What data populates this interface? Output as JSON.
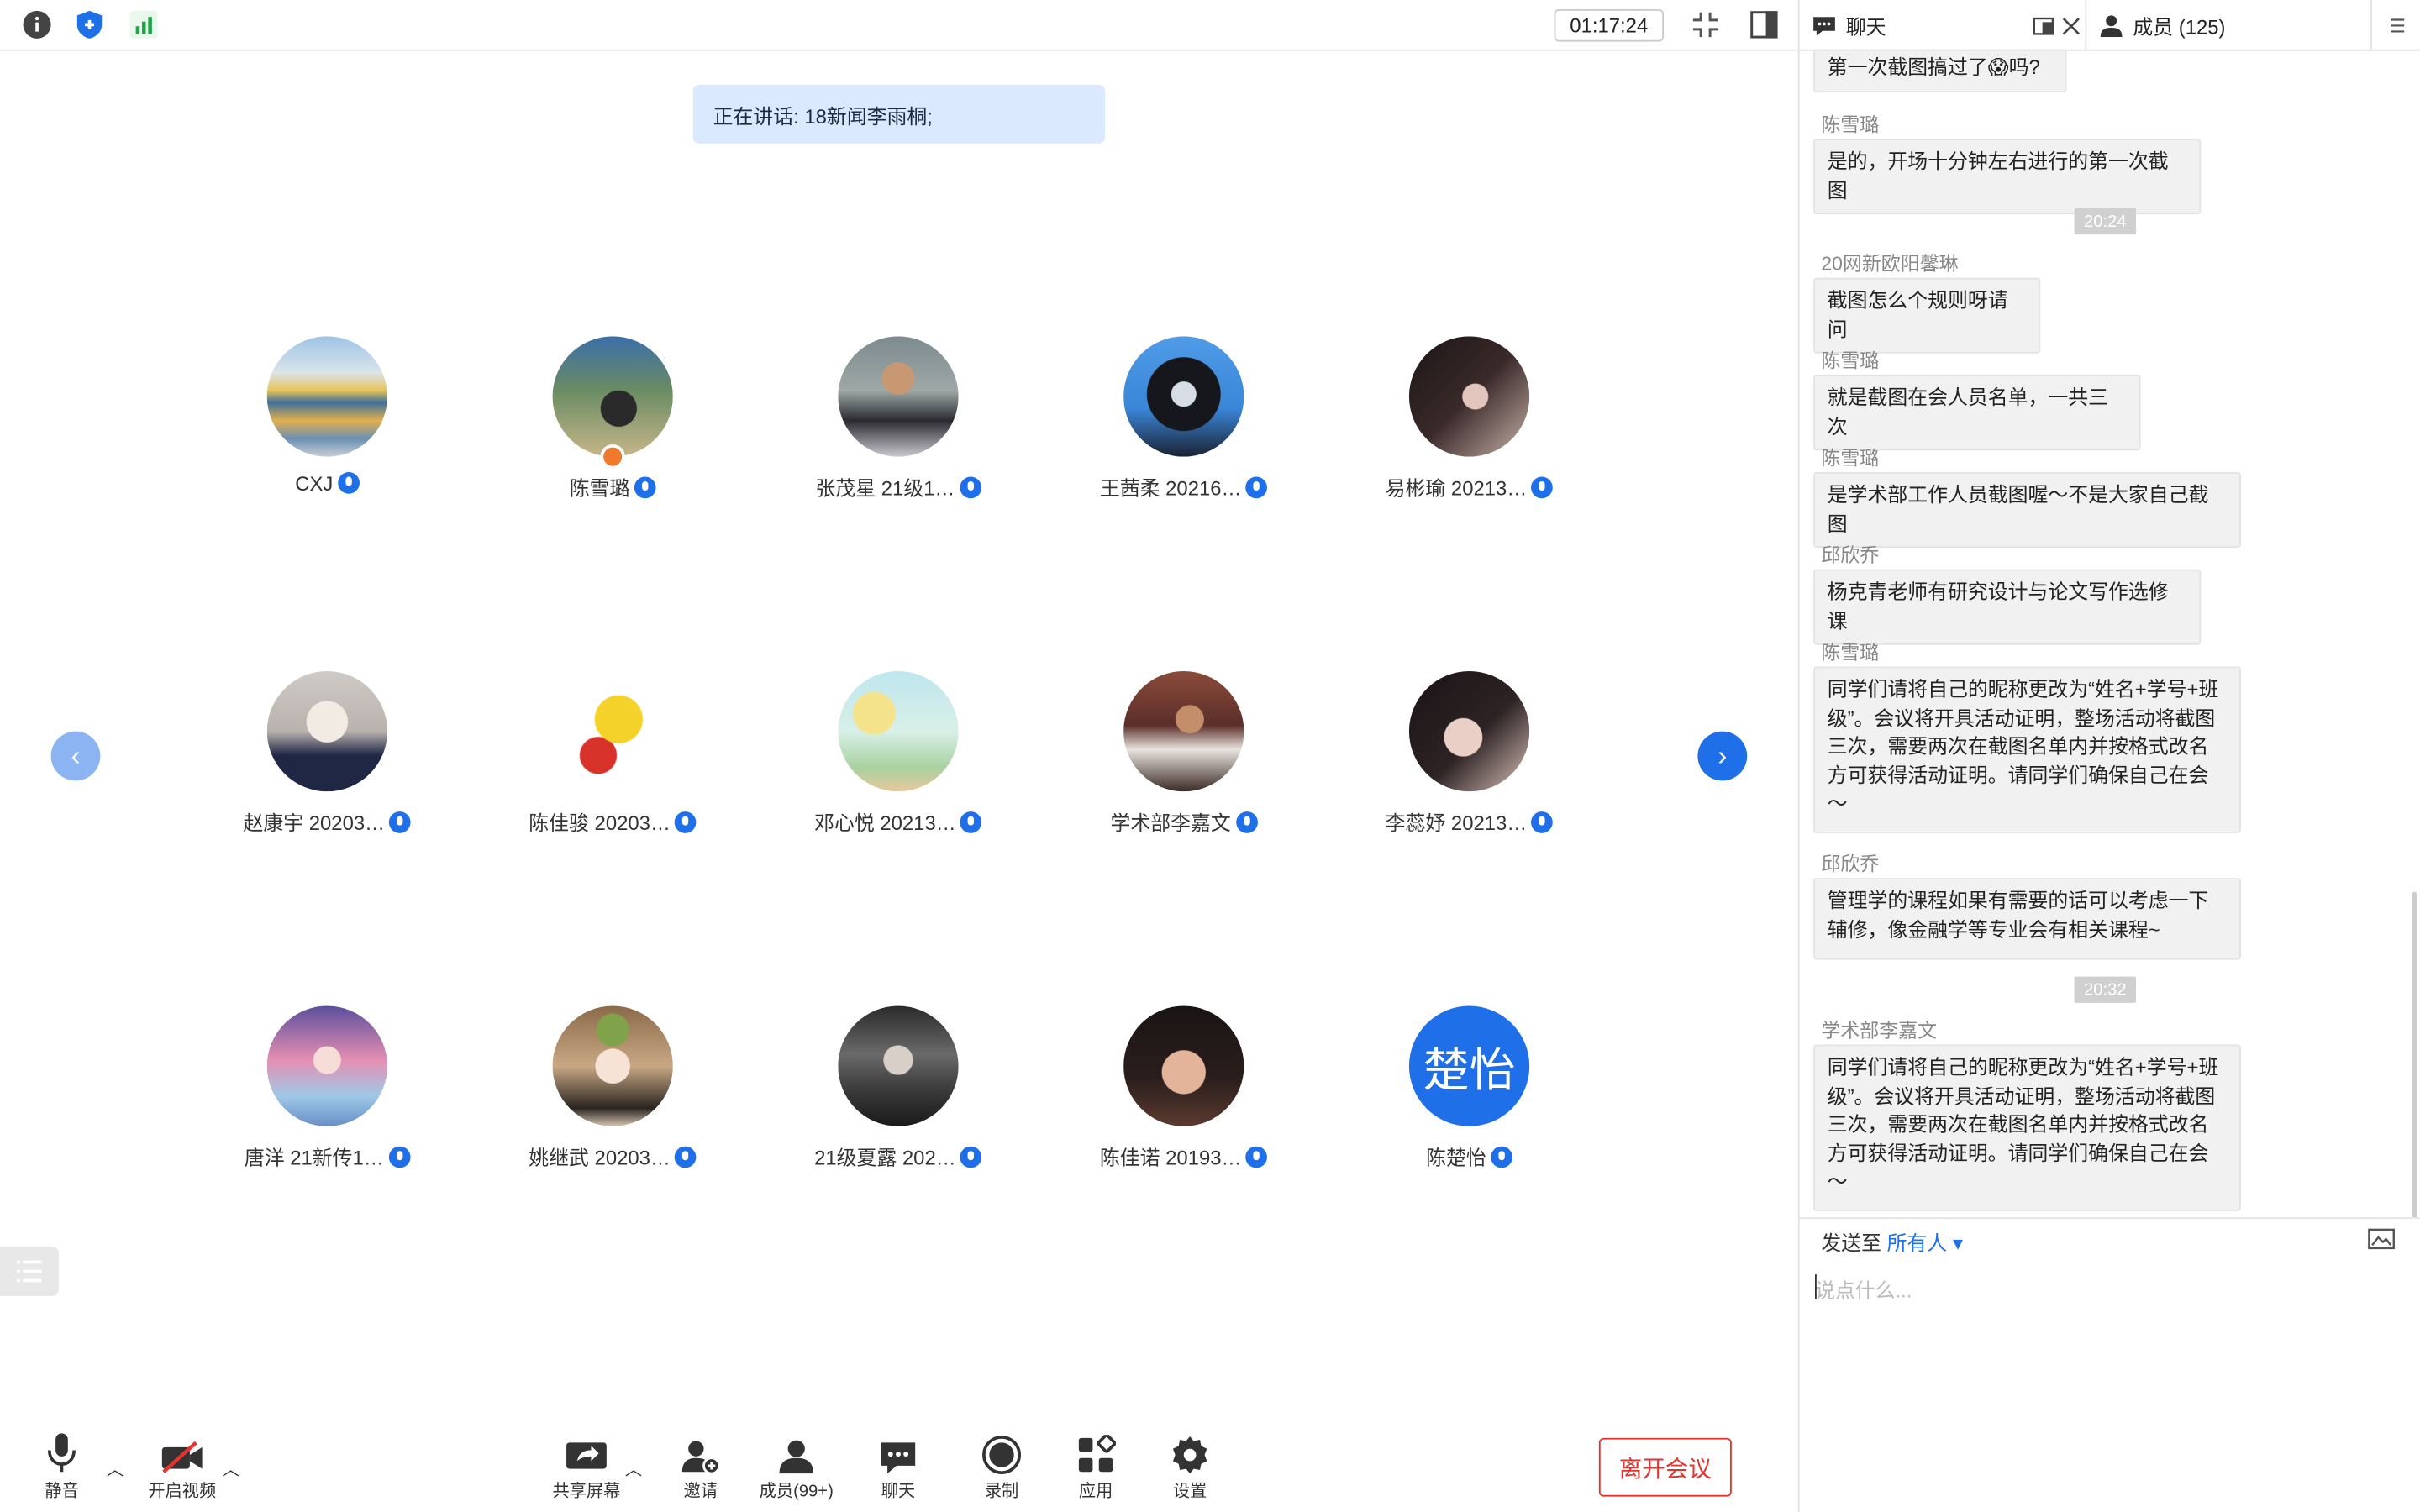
{
  "topbar": {
    "timer": "01:17:24"
  },
  "speaking": "正在讲话: 18新闻李雨桐;",
  "participants": [
    {
      "name": "CXJ"
    },
    {
      "name": "陈雪璐"
    },
    {
      "name": "张茂星 21级1…"
    },
    {
      "name": "王茜柔 20216…"
    },
    {
      "name": "易彬瑜 20213…"
    },
    {
      "name": "赵康宇 20203…"
    },
    {
      "name": "陈佳骏 20203…"
    },
    {
      "name": "邓心悦 20213…"
    },
    {
      "name": "学术部李嘉文"
    },
    {
      "name": "李蕊妤 20213…"
    },
    {
      "name": "唐洋 21新传1…"
    },
    {
      "name": "姚继武 20203…"
    },
    {
      "name": "21级夏露 202…"
    },
    {
      "name": "陈佳诺 20193…"
    },
    {
      "name": "陈楚怡",
      "initials": "楚怡"
    }
  ],
  "toolbar": {
    "mute": "静音",
    "video": "开启视频",
    "share": "共享屏幕",
    "invite": "邀请",
    "members": "成员(99+)",
    "chat": "聊天",
    "record": "录制",
    "apps": "应用",
    "settings": "设置",
    "leave": "离开会议"
  },
  "panel": {
    "chat_tab": "聊天",
    "members_tab": "成员 (125)",
    "send_to_label": "发送至",
    "send_to_value": "所有人",
    "input_placeholder": "说点什么..."
  },
  "chat": {
    "m0": "第一次截图搞过了😱吗?",
    "s1": "陈雪璐",
    "m1": "是的，开场十分钟左右进行的第一次截图",
    "t1": "20:24",
    "s2": "20网新欧阳馨琳",
    "m2": "截图怎么个规则呀请问",
    "s3": "陈雪璐",
    "m3": "就是截图在会人员名单，一共三次",
    "s4": "陈雪璐",
    "m4": "是学术部工作人员截图喔～不是大家自己截图",
    "s5": "邱欣乔",
    "m5": "杨克青老师有研究设计与论文写作选修课",
    "s6": "陈雪璐",
    "m6": "同学们请将自己的昵称更改为“姓名+学号+班级”。会议将开具活动证明，整场活动将截图三次，需要两次在截图名单内并按格式改名方可获得活动证明。请同学们确保自己在会～",
    "s7": "邱欣乔",
    "m7": "管理学的课程如果有需要的话可以考虑一下辅修，像金融学等专业会有相关课程~",
    "t2": "20:32",
    "s8": "学术部李嘉文",
    "m8": "同学们请将自己的昵称更改为“姓名+学号+班级”。会议将开具活动证明，整场活动将截图三次，需要两次在截图名单内并按格式改名方可获得活动证明。请同学们确保自己在会～"
  },
  "colors": {
    "accent": "#1e6fe8",
    "leave": "#e5322d",
    "speaking_bg": "#dbe9ff"
  }
}
